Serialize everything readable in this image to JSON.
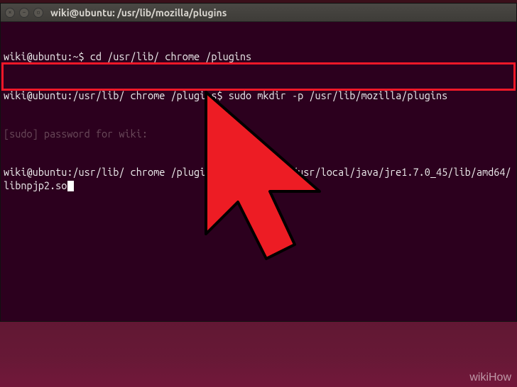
{
  "window": {
    "title": "wiki@ubuntu: /usr/lib/mozilla/plugins",
    "close_glyph": "×",
    "min_glyph": "–",
    "max_glyph": "▫"
  },
  "terminal": {
    "line1_prompt": "wiki@ubuntu:~$ ",
    "line1_cmd": "cd /usr/lib/ chrome /plugins",
    "line2_prompt": "wiki@ubuntu:/usr/lib/ chrome /plugins$ ",
    "line2_cmd": "sudo mkdir -p /usr/lib/mozilla/plugins",
    "line3_obscured": "[sudo] password for wiki:",
    "line4_prompt": "wiki@ubuntu:/usr/lib/ chrome /plugins$ ",
    "line4_cmd": "sudo ln -s /usr/local/java/jre1.7.0_45/lib/amd64/libnpjp2.so"
  },
  "watermark": "wikiHow",
  "colors": {
    "highlight": "#f01828",
    "terminal_bg": "#2c001e",
    "arrow_fill": "#ed1c24",
    "arrow_stroke": "#000000"
  }
}
